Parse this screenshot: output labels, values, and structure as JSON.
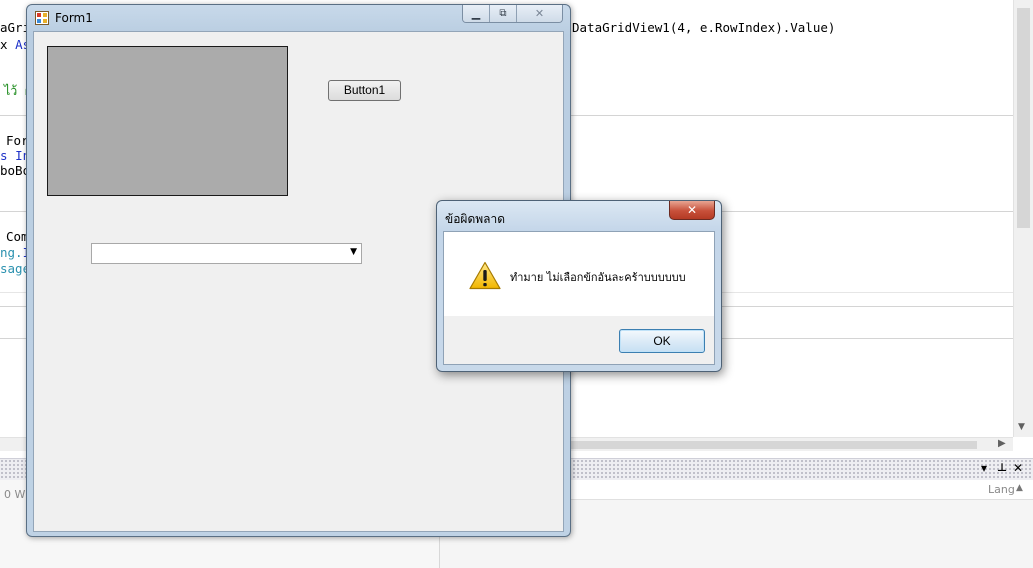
{
  "ide": {
    "code": {
      "l1_a": "aGri",
      "l1_b": "DataGridView1(4, e.RowIndex).Value)",
      "l2_a": "x ",
      "l2_kw": "As",
      "l3_comment": "ไว้ ผ",
      "l4": "For",
      "l5_a": "s ",
      "l5_kw": "In",
      "l6": "boBo",
      "l7": "Com",
      "l8_a": "ng.",
      "l8_kw": "I",
      "l9_cls": "sage"
    },
    "panel": {
      "left_text": "0 W",
      "lang_text": "Lang",
      "dropdown_icon": "▾",
      "pin_icon": "📌",
      "close_icon": "✕"
    }
  },
  "form1": {
    "title": "Form1",
    "button1_label": "Button1",
    "combobox_value": ""
  },
  "msgbox": {
    "title": "ข้อผิดพลาด",
    "message": "ทำมาย ไม่เลือกข้กอันละคร้าบบบบบบ",
    "ok_label": "OK"
  },
  "colors": {
    "picturebox": "#ababab",
    "msg_close": "#c7503a",
    "window_frame": "#bfd2e5"
  }
}
